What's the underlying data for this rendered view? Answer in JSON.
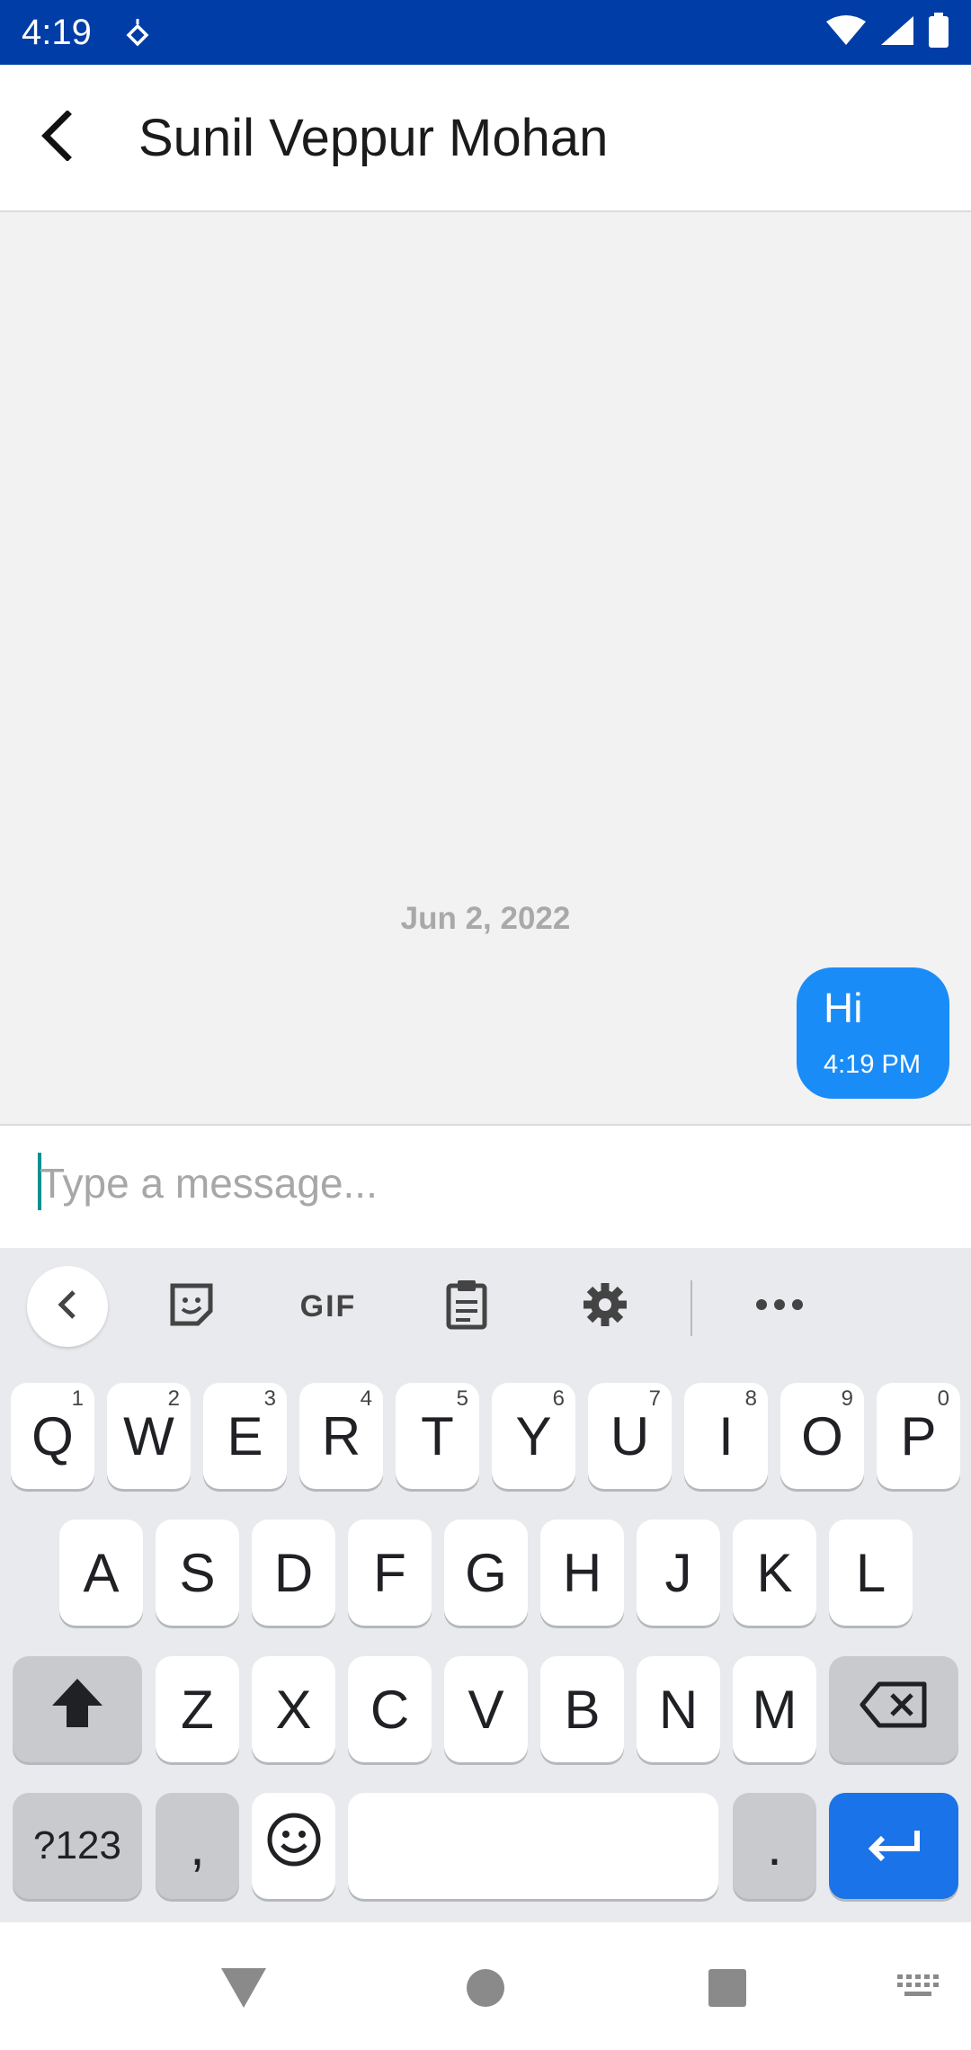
{
  "status_bar": {
    "time": "4:19",
    "icons": [
      "notification-icon",
      "wifi-icon",
      "signal-icon",
      "battery-icon"
    ]
  },
  "header": {
    "title": "Sunil Veppur Mohan",
    "back_icon": "back-arrow-icon"
  },
  "chat": {
    "date_separator": "Jun 2, 2022",
    "messages": [
      {
        "text": "Hi",
        "time": "4:19 PM",
        "outgoing": true
      }
    ]
  },
  "composer": {
    "placeholder": "Type a message..."
  },
  "keyboard": {
    "toolbar": [
      "collapse-icon",
      "sticker-icon",
      "gif-icon",
      "clipboard-icon",
      "settings-icon",
      "more-icon"
    ],
    "toolbar_gif_label": "GIF",
    "row1": [
      {
        "key": "Q",
        "hint": "1"
      },
      {
        "key": "W",
        "hint": "2"
      },
      {
        "key": "E",
        "hint": "3"
      },
      {
        "key": "R",
        "hint": "4"
      },
      {
        "key": "T",
        "hint": "5"
      },
      {
        "key": "Y",
        "hint": "6"
      },
      {
        "key": "U",
        "hint": "7"
      },
      {
        "key": "I",
        "hint": "8"
      },
      {
        "key": "O",
        "hint": "9"
      },
      {
        "key": "P",
        "hint": "0"
      }
    ],
    "row2": [
      "A",
      "S",
      "D",
      "F",
      "G",
      "H",
      "J",
      "K",
      "L"
    ],
    "row3": [
      "Z",
      "X",
      "C",
      "V",
      "B",
      "N",
      "M"
    ],
    "symbols_label": "?123",
    "comma_label": ",",
    "period_label": ".",
    "accent_color": "#1a73e8"
  },
  "nav_bar": {
    "icons": [
      "back-triangle-icon",
      "home-circle-icon",
      "recents-square-icon",
      "keyboard-switch-icon"
    ]
  }
}
